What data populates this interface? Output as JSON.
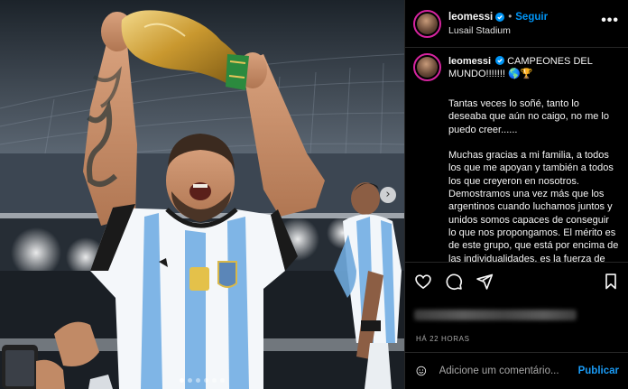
{
  "post": {
    "username": "leomessi",
    "follow_label": "Seguir",
    "location": "Lusail Stadium",
    "more_label": "•••",
    "caption_head": "CAMPEONES DEL MUNDO!!!!!!! 🌎🏆",
    "caption_body": "Tantas veces lo soñé, tanto lo deseaba que aún no caigo, no me lo puedo creer......\n\nMuchas gracias a mi familia, a todos los que me apoyan y también a todos los que creyeron en nosotros. Demostramos una vez más que los argentinos cuando luchamos juntos y unidos somos capaces de conseguir lo que nos propongamos. El mérito es de este grupo, que está por encima de las individualidades, es la fuerza de todos peleando por un mismo sueño que también era el de todos los argentinos...",
    "time_ago": "HÁ 22 HORAS",
    "comment_placeholder": "Adicione um comentário...",
    "publish_label": "Publicar",
    "carousel_next": "›"
  },
  "icons": {
    "verified": "verified-badge-icon",
    "like": "heart-icon",
    "comment": "comment-bubble-icon",
    "share": "paper-plane-icon",
    "save": "bookmark-icon",
    "emoji": "smiley-icon"
  },
  "colors": {
    "accent": "#0095f6",
    "background": "#000000",
    "divider": "#262626",
    "jersey_blue": "#7fb5e6"
  },
  "carousel": {
    "slides": 6,
    "active_index": 0
  }
}
